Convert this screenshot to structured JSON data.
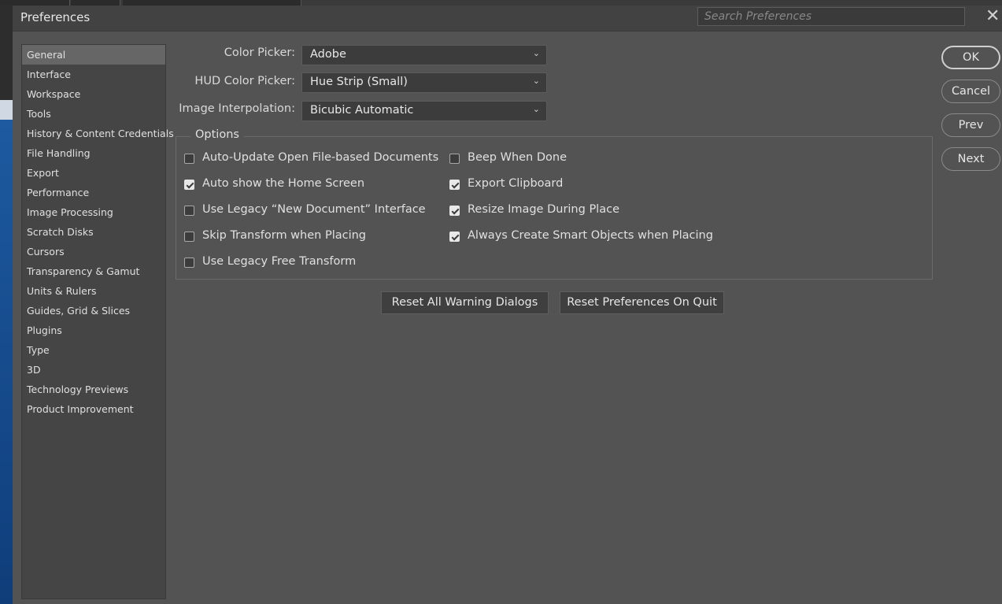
{
  "dialog": {
    "title": "Preferences",
    "search_placeholder": "Search Preferences",
    "close_glyph": "✕"
  },
  "sidebar": {
    "items": [
      {
        "label": "General"
      },
      {
        "label": "Interface"
      },
      {
        "label": "Workspace"
      },
      {
        "label": "Tools"
      },
      {
        "label": "History & Content Credentials"
      },
      {
        "label": "File Handling"
      },
      {
        "label": "Export"
      },
      {
        "label": "Performance"
      },
      {
        "label": "Image Processing"
      },
      {
        "label": "Scratch Disks"
      },
      {
        "label": "Cursors"
      },
      {
        "label": "Transparency & Gamut"
      },
      {
        "label": "Units & Rulers"
      },
      {
        "label": "Guides, Grid & Slices"
      },
      {
        "label": "Plugins"
      },
      {
        "label": "Type"
      },
      {
        "label": "3D"
      },
      {
        "label": "Technology Previews"
      },
      {
        "label": "Product Improvement"
      }
    ],
    "selected": "General"
  },
  "form": {
    "color_picker": {
      "label": "Color Picker:",
      "value": "Adobe"
    },
    "hud_color_picker": {
      "label": "HUD Color Picker:",
      "value": "Hue Strip (Small)"
    },
    "image_interpolation": {
      "label": "Image Interpolation:",
      "value": "Bicubic Automatic"
    }
  },
  "options": {
    "legend": "Options",
    "left": [
      {
        "label": "Auto-Update Open File-based Documents",
        "checked": false
      },
      {
        "label": "Auto show the Home Screen",
        "checked": true
      },
      {
        "label": "Use Legacy “New Document” Interface",
        "checked": false
      },
      {
        "label": "Skip Transform when Placing",
        "checked": false
      },
      {
        "label": "Use Legacy Free Transform",
        "checked": false
      }
    ],
    "right": [
      {
        "label": "Beep When Done",
        "checked": false
      },
      {
        "label": "Export Clipboard",
        "checked": true
      },
      {
        "label": "Resize Image During Place",
        "checked": true
      },
      {
        "label": "Always Create Smart Objects when Placing",
        "checked": true
      }
    ]
  },
  "actions": {
    "reset_warnings": "Reset All Warning Dialogs",
    "reset_on_quit": "Reset Preferences On Quit"
  },
  "buttons": {
    "ok": "OK",
    "cancel": "Cancel",
    "prev": "Prev",
    "next": "Next"
  }
}
